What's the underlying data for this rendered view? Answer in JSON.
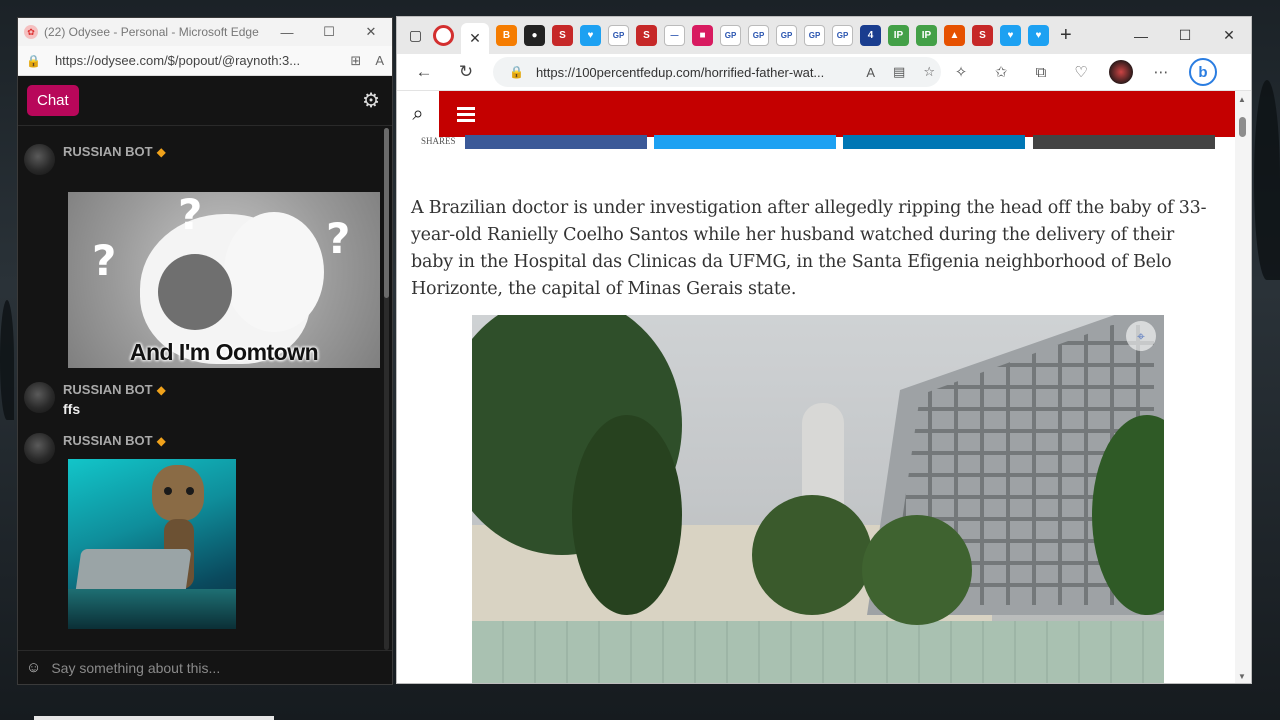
{
  "odysee": {
    "window_title": "(22) Odysee - Personal - Microsoft Edge",
    "url": "https://odysee.com/$/popout/@raynoth:3...",
    "chat_tab": "Chat",
    "input_placeholder": "Say something about this...",
    "messages": [
      {
        "author": "RUSSIAN BOT",
        "image_caption": "And I'm Oomtown"
      },
      {
        "author": "RUSSIAN BOT",
        "text": "ffs"
      },
      {
        "author": "RUSSIAN BOT"
      }
    ]
  },
  "edge": {
    "url": "https://100percentfedup.com/horrified-father-wat...",
    "tabs": [
      {
        "icon": "record-icon",
        "color": "#d32f2f"
      },
      {
        "icon": "close-icon",
        "active": true
      },
      {
        "icon": "blogger-icon",
        "label": "B",
        "color": "#f57c00"
      },
      {
        "icon": "mask-icon",
        "label": "●",
        "color": "#222"
      },
      {
        "icon": "s-icon",
        "label": "S",
        "color": "#c62828"
      },
      {
        "icon": "twitter-icon",
        "label": "♥",
        "color": "#1da1f2"
      },
      {
        "icon": "gp-icon",
        "label": "GP",
        "color": "#ffffff"
      },
      {
        "icon": "s-icon",
        "label": "S",
        "color": "#c62828"
      },
      {
        "icon": "bar-icon",
        "label": "—",
        "color": "#ffffff"
      },
      {
        "icon": "square-icon",
        "label": "■",
        "color": "#d81b60"
      },
      {
        "icon": "gp-icon",
        "label": "GP",
        "color": "#ffffff"
      },
      {
        "icon": "gp-icon",
        "label": "GP",
        "color": "#ffffff"
      },
      {
        "icon": "gp-icon",
        "label": "GP",
        "color": "#ffffff"
      },
      {
        "icon": "gp-icon",
        "label": "GP",
        "color": "#ffffff"
      },
      {
        "icon": "gp-icon",
        "label": "GP",
        "color": "#ffffff"
      },
      {
        "icon": "flag-icon",
        "label": "4",
        "color": "#1a3d8f"
      },
      {
        "icon": "ip-icon",
        "label": "IP",
        "color": "#43a047"
      },
      {
        "icon": "ip-icon",
        "label": "IP",
        "color": "#43a047"
      },
      {
        "icon": "hat-icon",
        "label": "▲",
        "color": "#e65100"
      },
      {
        "icon": "s-icon",
        "label": "S",
        "color": "#c62828"
      },
      {
        "icon": "twitter-icon",
        "label": "♥",
        "color": "#1da1f2"
      },
      {
        "icon": "twitter-icon",
        "label": "♥",
        "color": "#1da1f2"
      }
    ],
    "site": {
      "header_color": "#c40000",
      "shares_label": "SHARES",
      "share_buttons": [
        {
          "name": "facebook",
          "color": "#3b5998"
        },
        {
          "name": "twitter",
          "color": "#1da1f2"
        },
        {
          "name": "linkedin",
          "color": "#0077b5"
        },
        {
          "name": "email",
          "color": "#444444"
        }
      ],
      "article_paragraph": "A Brazilian doctor is under investigation after allegedly ripping the head off the baby of 33-year-old Ranielly Coelho Santos while her husband watched during the delivery of their baby in the Hospital das Clinicas da UFMG, in the Santa Efigenia neighborhood of Belo Horizonte, the capital of Minas Gerais state."
    }
  }
}
